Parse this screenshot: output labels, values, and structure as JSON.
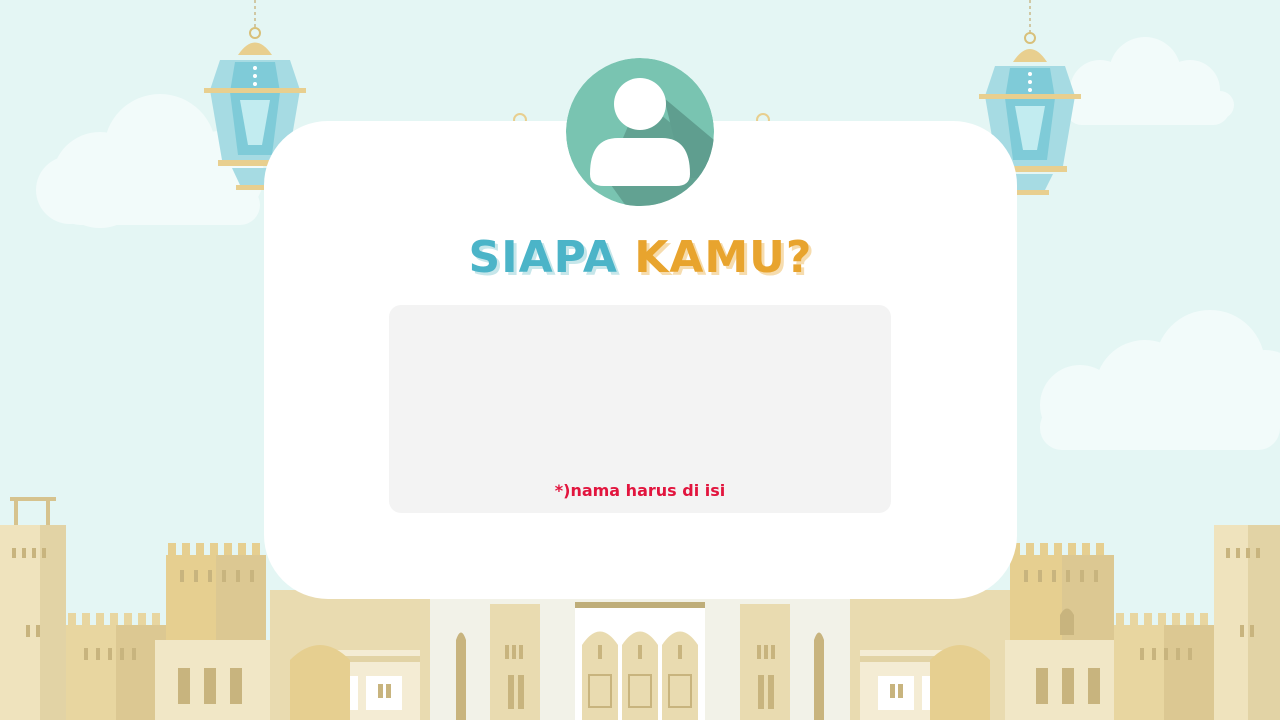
{
  "title": {
    "word1": "SIAPA",
    "word2": "KAMU?"
  },
  "name_field": {
    "value": "",
    "placeholder": ""
  },
  "error_message": "*)nama harus di isi",
  "colors": {
    "sky": "#e4f6f4",
    "title_blue": "#4bb4c8",
    "title_orange": "#e8a42e",
    "avatar_bg": "#79c4b1",
    "error": "#e2153e",
    "field_bg": "#f3f3f3"
  },
  "icons": {
    "avatar": "user-avatar-icon",
    "lanterns": "hanging-lantern-icon"
  }
}
